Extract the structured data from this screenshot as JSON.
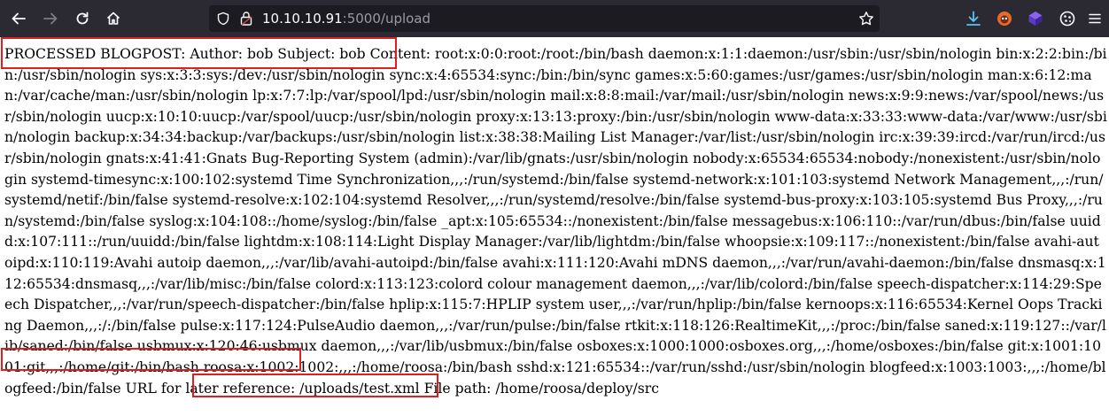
{
  "browser": {
    "url_host": "10.10.10.91",
    "url_rest": ":5000/upload"
  },
  "page": {
    "processed_label": "PROCESSED BLOGPOST: Author: bob Subject: bob Content:",
    "passwd_before_roosa": "root:x:0:0:root:/root:/bin/bash daemon:x:1:1:daemon:/usr/sbin:/usr/sbin/nologin bin:x:2:2:bin:/bin:/usr/sbin/nologin sys:x:3:3:sys:/dev:/usr/sbin/nologin sync:x:4:65534:sync:/bin:/bin/sync games:x:5:60:games:/usr/games:/usr/sbin/nologin man:x:6:12:man:/var/cache/man:/usr/sbin/nologin lp:x:7:7:lp:/var/spool/lpd:/usr/sbin/nologin mail:x:8:8:mail:/var/mail:/usr/sbin/nologin news:x:9:9:news:/var/spool/news:/usr/sbin/nologin uucp:x:10:10:uucp:/var/spool/uucp:/usr/sbin/nologin proxy:x:13:13:proxy:/bin:/usr/sbin/nologin www-data:x:33:33:www-data:/var/www:/usr/sbin/nologin backup:x:34:34:backup:/var/backups:/usr/sbin/nologin list:x:38:38:Mailing List Manager:/var/list:/usr/sbin/nologin irc:x:39:39:ircd:/var/run/ircd:/usr/sbin/nologin gnats:x:41:41:Gnats Bug-Reporting System (admin):/var/lib/gnats:/usr/sbin/nologin nobody:x:65534:65534:nobody:/nonexistent:/usr/sbin/nologin systemd-timesync:x:100:102:systemd Time Synchronization,,,:/run/systemd:/bin/false systemd-network:x:101:103:systemd Network Management,,,:/run/systemd/netif:/bin/false systemd-resolve:x:102:104:systemd Resolver,,,:/run/systemd/resolve:/bin/false systemd-bus-proxy:x:103:105:systemd Bus Proxy,,,:/run/systemd:/bin/false syslog:x:104:108::/home/syslog:/bin/false _apt:x:105:65534::/nonexistent:/bin/false messagebus:x:106:110::/var/run/dbus:/bin/false uuidd:x:107:111::/run/uuidd:/bin/false lightdm:x:108:114:Light Display Manager:/var/lib/lightdm:/bin/false whoopsie:x:109:117::/nonexistent:/bin/false avahi-autoipd:x:110:119:Avahi autoip daemon,,,:/var/lib/avahi-autoipd:/bin/false avahi:x:111:120:Avahi mDNS daemon,,,:/var/run/avahi-daemon:/bin/false dnsmasq:x:112:65534:dnsmasq,,,:/var/lib/misc:/bin/false colord:x:113:123:colord colour management daemon,,,:/var/lib/colord:/bin/false speech-dispatcher:x:114:29:Speech Dispatcher,,,:/var/run/speech-dispatcher:/bin/false hplip:x:115:7:HPLIP system user,,,:/var/run/hplip:/bin/false kernoops:x:116:65534:Kernel Oops Tracking Daemon,,,:/:/bin/false pulse:x:117:124:PulseAudio daemon,,,:/var/run/pulse:/bin/false rtkit:x:118:126:RealtimeKit,,,:/proc:/bin/false saned:x:119:127::/var/lib/saned:/bin/false usbmux:x:120:46:usbmux daemon,,,:/var/lib/usbmux:/bin/false osboxes:x:1000:1000:osboxes.org,,,:/home/osboxes:/bin/false git:x:1001:1001:git,,,:/home/git:/bin/bash",
    "roosa_line": "roosa:x:1002:1002:,,,:/home/roosa:/bin/bash",
    "passwd_after_roosa": "sshd:x:121:65534::/var/run/sshd:/usr/sbin/nologin blogfeed:x:1003:1003:,,,:/home/blogfeed:/bin/false",
    "url_reference": "URL for later reference: /uploads/test.xml",
    "file_path": "File path: /home/roosa/deploy/src"
  },
  "colors": {
    "toolbar": "#2b2a33",
    "urlbar": "#1c1b22",
    "highlight_box": "#e01e1e"
  },
  "icons": [
    "back-icon",
    "forward-icon",
    "reload-icon",
    "home-icon",
    "shield-icon",
    "lock-icon",
    "star-icon",
    "download-icon",
    "extension-icons"
  ]
}
